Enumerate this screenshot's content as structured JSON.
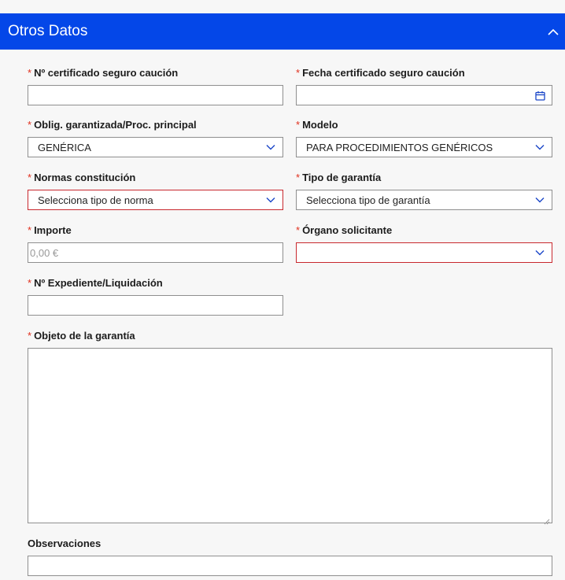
{
  "panel": {
    "title": "Otros Datos"
  },
  "required_mark": "*",
  "fields": {
    "certificado": {
      "label": "Nº certificado seguro caución",
      "value": ""
    },
    "fecha": {
      "label": "Fecha certificado seguro caución",
      "value": "",
      "icon": "calendar-icon"
    },
    "oblig": {
      "label": "Oblig. garantizada/Proc. principal",
      "value": "GENÉRICA"
    },
    "modelo": {
      "label": "Modelo",
      "value": "PARA PROCEDIMIENTOS GENÉRICOS"
    },
    "normas": {
      "label": "Normas constitución",
      "value": "Selecciona tipo de norma"
    },
    "tipo": {
      "label": "Tipo de garantía",
      "value": "Selecciona tipo de garantía"
    },
    "importe": {
      "label": "Importe",
      "placeholder": "0,00 €"
    },
    "organo": {
      "label": "Órgano solicitante",
      "value": ""
    },
    "expediente": {
      "label": "Nº Expediente/Liquidación",
      "value": ""
    },
    "objeto": {
      "label": "Objeto de la garantía",
      "value": ""
    },
    "observaciones": {
      "label": "Observaciones",
      "value": ""
    }
  },
  "colors": {
    "header": "#0447e8",
    "accent": "#1a46c8",
    "invalid": "#c8282e",
    "required": "#e0301e"
  }
}
